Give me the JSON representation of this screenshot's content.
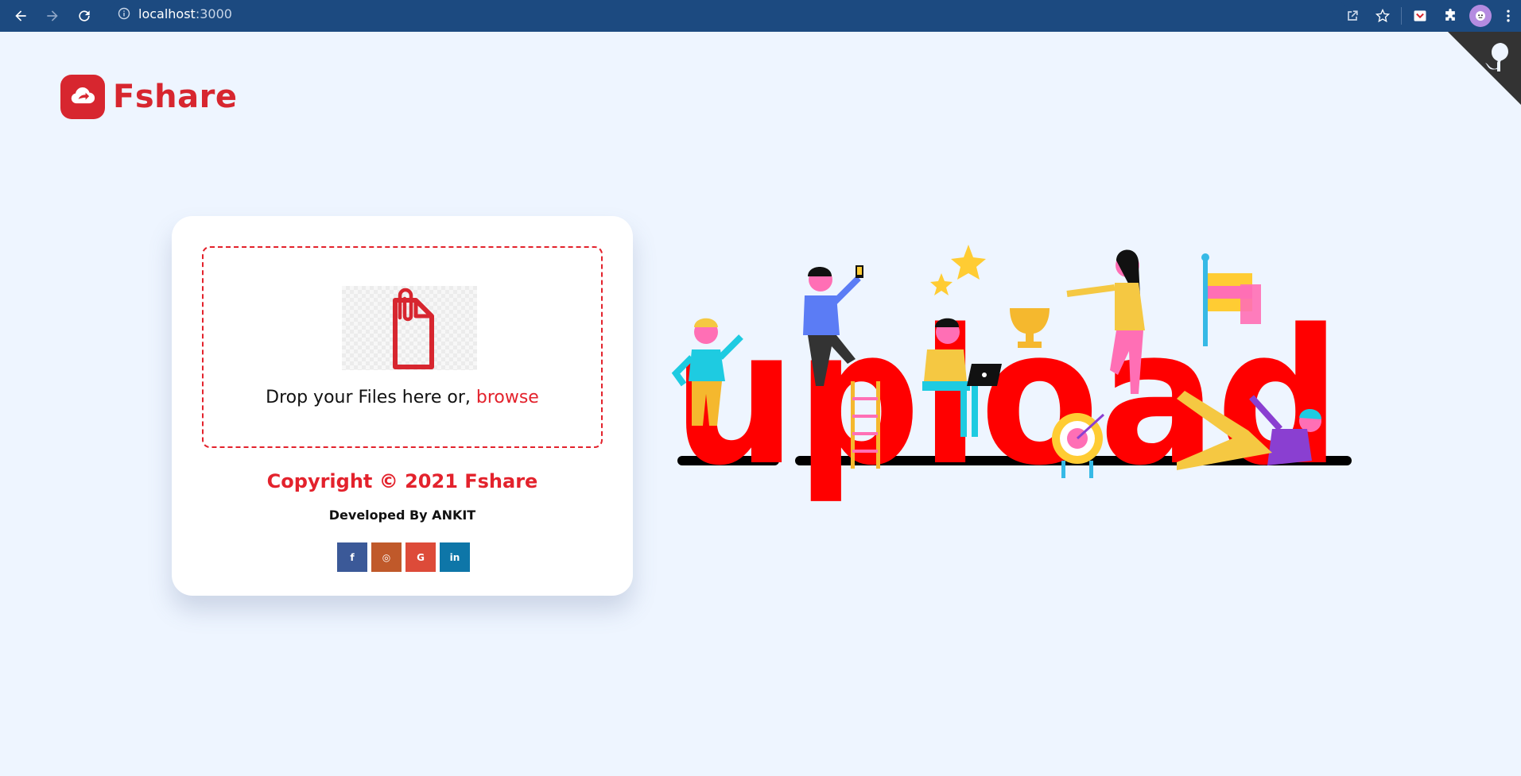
{
  "browser": {
    "url_host": "localhost",
    "url_port": ":3000",
    "icons": [
      "back-icon",
      "forward-icon",
      "reload-icon",
      "info-icon",
      "share-icon",
      "star-icon",
      "extension-pocket-icon",
      "puzzle-icon",
      "profile-avatar",
      "kebab-menu-icon"
    ]
  },
  "brand": {
    "name": "Fshare",
    "color": "#d7262f"
  },
  "upload": {
    "drop_text": "Drop your Files here or,",
    "browse_label": "browse"
  },
  "footer": {
    "copyright": "Copyright © 2021 Fshare",
    "developed_by": "Developed By ANKIT"
  },
  "socials": [
    {
      "label": "f",
      "color": "#3b5998",
      "icon": "facebook-icon"
    },
    {
      "label": "◎",
      "color": "#c0592a",
      "icon": "instagram-icon"
    },
    {
      "label": "G",
      "color": "#dd4b39",
      "icon": "google-icon"
    },
    {
      "label": "in",
      "color": "#0e76a8",
      "icon": "linkedin-icon"
    }
  ],
  "illustration": {
    "word": "upload",
    "color": "#ff0000"
  }
}
